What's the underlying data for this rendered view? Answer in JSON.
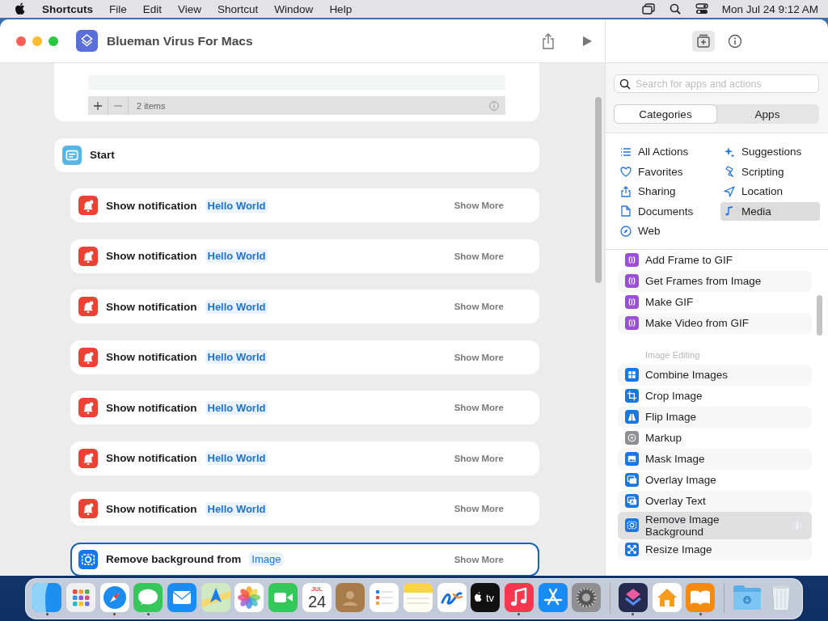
{
  "menubar": {
    "app": "Shortcuts",
    "menus": [
      "File",
      "Edit",
      "View",
      "Shortcut",
      "Window",
      "Help"
    ],
    "clock": "Mon Jul 24  9:12 AM"
  },
  "window": {
    "title": "Blueman Virus For Macs"
  },
  "editor": {
    "list_footer": {
      "count": "2 items"
    },
    "actions": [
      {
        "kind": "start",
        "title": "Start",
        "selected": false
      },
      {
        "kind": "notification",
        "title": "Show notification",
        "parameter": "Hello World",
        "more": "Show More",
        "selected": false
      },
      {
        "kind": "notification",
        "title": "Show notification",
        "parameter": "Hello World",
        "more": "Show More",
        "selected": false
      },
      {
        "kind": "notification",
        "title": "Show notification",
        "parameter": "Hello World",
        "more": "Show More",
        "selected": false
      },
      {
        "kind": "notification",
        "title": "Show notification",
        "parameter": "Hello World",
        "more": "Show More",
        "selected": false
      },
      {
        "kind": "notification",
        "title": "Show notification",
        "parameter": "Hello World",
        "more": "Show More",
        "selected": false
      },
      {
        "kind": "notification",
        "title": "Show notification",
        "parameter": "Hello World",
        "more": "Show More",
        "selected": false
      },
      {
        "kind": "notification",
        "title": "Show notification",
        "parameter": "Hello World",
        "more": "Show More",
        "selected": false
      },
      {
        "kind": "remove-background",
        "title": "Remove background from",
        "parameter": "Image",
        "more": "Show More",
        "selected": true
      }
    ]
  },
  "library": {
    "search": {
      "placeholder": "Search for apps and actions"
    },
    "segments": [
      {
        "label": "Categories",
        "selected": true
      },
      {
        "label": "Apps",
        "selected": false
      }
    ],
    "categories": [
      {
        "kind": "list",
        "label": "All Actions",
        "selected": false
      },
      {
        "kind": "sparkle",
        "label": "Suggestions",
        "selected": false
      },
      {
        "kind": "heart",
        "label": "Favorites",
        "selected": false
      },
      {
        "kind": "script",
        "label": "Scripting",
        "selected": false
      },
      {
        "kind": "share",
        "label": "Sharing",
        "selected": false
      },
      {
        "kind": "location",
        "label": "Location",
        "selected": false
      },
      {
        "kind": "document",
        "label": "Documents",
        "selected": false
      },
      {
        "kind": "note",
        "label": "Media",
        "selected": true
      },
      {
        "kind": "compass",
        "label": "Web",
        "selected": false
      }
    ],
    "sections": [
      {
        "items": [
          {
            "kind": "gif",
            "label": "Add Frame to GIF",
            "selected": false
          },
          {
            "kind": "gif",
            "label": "Get Frames from Image",
            "selected": false
          },
          {
            "kind": "gif",
            "label": "Make GIF",
            "selected": false
          },
          {
            "kind": "gif",
            "label": "Make Video from GIF",
            "selected": false
          }
        ]
      },
      {
        "title": "Image Editing",
        "items": [
          {
            "kind": "combine",
            "label": "Combine Images",
            "selected": false
          },
          {
            "kind": "crop",
            "label": "Crop Image",
            "selected": false
          },
          {
            "kind": "flip",
            "label": "Flip Image",
            "selected": false
          },
          {
            "kind": "markup",
            "label": "Markup",
            "selected": false
          },
          {
            "kind": "mask",
            "label": "Mask Image",
            "selected": false
          },
          {
            "kind": "overlay",
            "label": "Overlay Image",
            "selected": false
          },
          {
            "kind": "overlay-text",
            "label": "Overlay Text",
            "selected": false
          },
          {
            "kind": "remove-bg",
            "label": "Remove Image Background",
            "selected": true
          },
          {
            "kind": "resize",
            "label": "Resize Image",
            "selected": false
          }
        ]
      }
    ]
  },
  "dock": {
    "groups": [
      {
        "apps": [
          {
            "kind": "finder",
            "running": true
          },
          {
            "kind": "launchpad",
            "running": false
          },
          {
            "kind": "safari",
            "running": true
          },
          {
            "kind": "messages",
            "running": true
          },
          {
            "kind": "mail",
            "running": false
          },
          {
            "kind": "maps",
            "running": false
          },
          {
            "kind": "photos",
            "running": false
          },
          {
            "kind": "facetime",
            "running": false
          },
          {
            "kind": "calendar",
            "month": "JUL",
            "day": "24",
            "running": false
          },
          {
            "kind": "contacts",
            "running": false
          },
          {
            "kind": "reminders",
            "running": false
          },
          {
            "kind": "notes",
            "running": false
          },
          {
            "kind": "freeform",
            "running": false
          },
          {
            "kind": "tv",
            "label": "tv",
            "running": false
          },
          {
            "kind": "music",
            "running": true
          },
          {
            "kind": "appstore",
            "running": false
          },
          {
            "kind": "settings",
            "running": false
          }
        ]
      },
      {
        "apps": [
          {
            "kind": "shortcuts",
            "running": true
          },
          {
            "kind": "home",
            "running": false
          },
          {
            "kind": "books",
            "running": true
          }
        ]
      },
      {
        "apps": [
          {
            "kind": "downloads",
            "running": false
          },
          {
            "kind": "trash",
            "running": false
          }
        ]
      }
    ]
  }
}
